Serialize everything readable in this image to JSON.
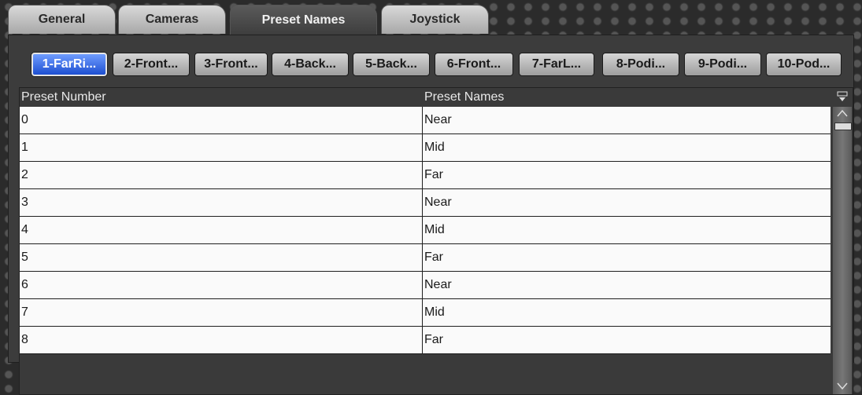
{
  "tabs": [
    {
      "label": "General",
      "active": false
    },
    {
      "label": "Cameras",
      "active": false
    },
    {
      "label": "Preset Names",
      "active": true
    },
    {
      "label": "Joystick",
      "active": false
    }
  ],
  "camera_buttons": [
    {
      "label": "1-FarRi...",
      "active": true
    },
    {
      "label": "2-Front...",
      "active": false
    },
    {
      "label": "3-Front...",
      "active": false
    },
    {
      "label": "4-Back...",
      "active": false
    },
    {
      "label": "5-Back...",
      "active": false
    },
    {
      "label": "6-Front...",
      "active": false
    },
    {
      "label": "7-FarL...",
      "active": false
    },
    {
      "label": "8-Podi...",
      "active": false
    },
    {
      "label": "9-Podi...",
      "active": false
    },
    {
      "label": "10-Pod...",
      "active": false
    }
  ],
  "table": {
    "headers": [
      "Preset Number",
      "Preset Names"
    ],
    "rows": [
      [
        "0",
        "Near"
      ],
      [
        "1",
        "Mid"
      ],
      [
        "2",
        "Far"
      ],
      [
        "3",
        "Near"
      ],
      [
        "4",
        "Mid"
      ],
      [
        "5",
        "Far"
      ],
      [
        "6",
        "Near"
      ],
      [
        "7",
        "Mid"
      ],
      [
        "8",
        "Far"
      ]
    ]
  },
  "icons": {
    "column_menu": "column-chooser-icon",
    "scroll_up": "chevron-up-icon",
    "scroll_down": "chevron-down-icon"
  }
}
